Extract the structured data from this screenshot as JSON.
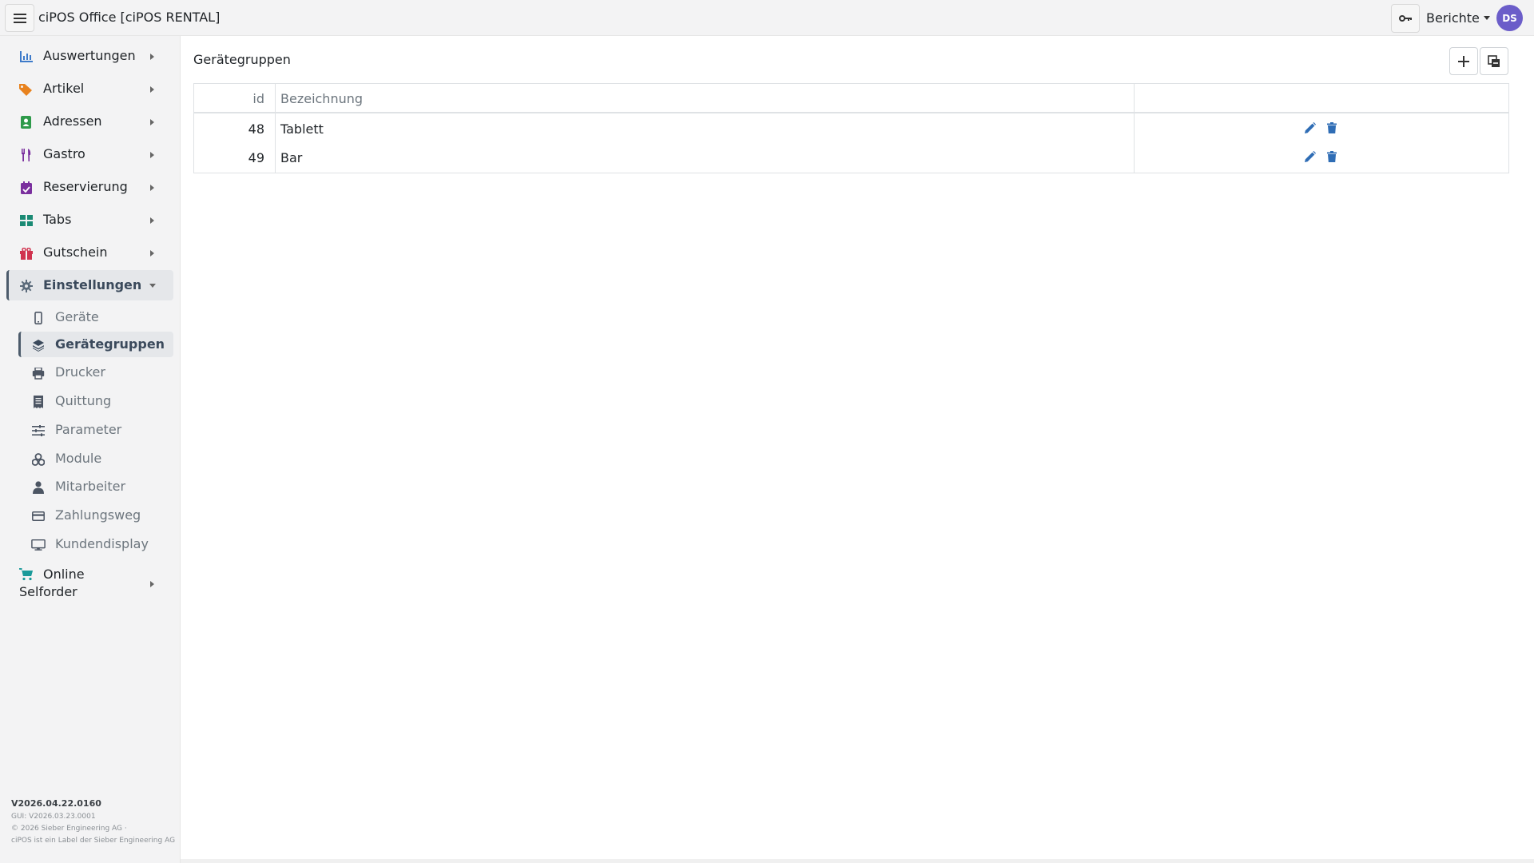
{
  "app": {
    "title": "ciPOS Office [ciPOS RENTAL]"
  },
  "header": {
    "reports_label": "Berichte",
    "avatar_initials": "DS"
  },
  "sidebar": {
    "items": [
      {
        "label": "Auswertungen",
        "icon": "chart-icon",
        "color": "#3d7ac9"
      },
      {
        "label": "Artikel",
        "icon": "tags-icon",
        "color": "#e8821e"
      },
      {
        "label": "Adressen",
        "icon": "address-book-icon",
        "color": "#2e9a4a"
      },
      {
        "label": "Gastro",
        "icon": "utensils-icon",
        "color": "#7a2f9e"
      },
      {
        "label": "Reservierung",
        "icon": "calendar-check-icon",
        "color": "#7a2f9e"
      },
      {
        "label": "Tabs",
        "icon": "grid-icon",
        "color": "#1a8a74"
      },
      {
        "label": "Gutschein",
        "icon": "gift-icon",
        "color": "#d0324e"
      },
      {
        "label": "Einstellungen",
        "icon": "gear-icon",
        "color": "#5b6b7b"
      }
    ],
    "sub_items": [
      {
        "label": "Geräte",
        "icon": "mobile-icon"
      },
      {
        "label": "Gerätegruppen",
        "icon": "layers-icon"
      },
      {
        "label": "Drucker",
        "icon": "printer-icon"
      },
      {
        "label": "Quittung",
        "icon": "receipt-icon"
      },
      {
        "label": "Parameter",
        "icon": "sliders-icon"
      },
      {
        "label": "Module",
        "icon": "cubes-icon"
      },
      {
        "label": "Mitarbeiter",
        "icon": "user-icon"
      },
      {
        "label": "Zahlungsweg",
        "icon": "credit-card-icon"
      },
      {
        "label": "Kundendisplay",
        "icon": "monitor-icon"
      }
    ],
    "online": {
      "line1": "Online",
      "line2": "Selforder",
      "icon": "cart-icon",
      "color": "#1a9a9a"
    },
    "footer": {
      "version": "V2026.04.22.0160",
      "gui": "GUI: V2026.03.23.0001",
      "copyright": "© 2026 Sieber Engineering AG ·",
      "label_note": "ciPOS ist ein Label der Sieber Engineering AG"
    }
  },
  "main": {
    "title": "Gerätegruppen",
    "table": {
      "headers": {
        "id": "id",
        "name": "Bezeichnung"
      },
      "rows": [
        {
          "id": "48",
          "name": "Tablett"
        },
        {
          "id": "49",
          "name": "Bar"
        }
      ]
    }
  },
  "colors": {
    "accent": "#2f6db5",
    "avatar": "#6b5dc9"
  }
}
